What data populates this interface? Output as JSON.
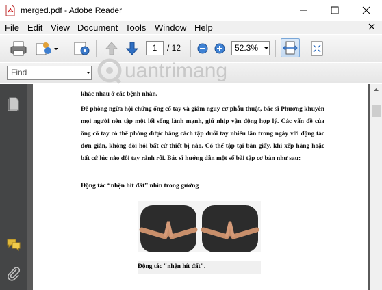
{
  "window": {
    "title": "merged.pdf - Adobe Reader"
  },
  "menu": {
    "items": [
      "File",
      "Edit",
      "View",
      "Document",
      "Tools",
      "Window",
      "Help"
    ]
  },
  "toolbar": {
    "current_page": "1",
    "page_total": "/ 12",
    "zoom": "52.3%"
  },
  "findbar": {
    "placeholder": "Find"
  },
  "watermark": {
    "text": "uantrimang"
  },
  "document": {
    "line_top": "khác nhau ở các bệnh nhân.",
    "paragraph1": "Để phòng ngừa hội chứng ống cổ tay và giảm nguy cơ phẫu thuật, bác sĩ Phương khuyên mọi người nên tập một lối sống lành mạnh, giữ nhịp vận động hợp lý. Các vấn đề của ống cổ tay có thể phòng được bằng cách tập duỗi tay nhiều lần trong ngày với động tác đơn giản, không đòi hỏi bất cứ thiết bị nào. Có thể tập tại bàn giấy, khi xếp hàng hoặc bất cứ lúc nào đôi tay rảnh rỗi. Bác sĩ hướng dẫn một số bài tập cơ bản như sau:",
    "heading": "Động tác “nhện hít đất” nhìn trong gương",
    "caption": "Động tác \"nhện hít đất\"."
  },
  "colors": {
    "nav_bg": "#444546",
    "doc_bg": "#5a5a5a",
    "toolbar_blue": "#2f6fc3"
  }
}
